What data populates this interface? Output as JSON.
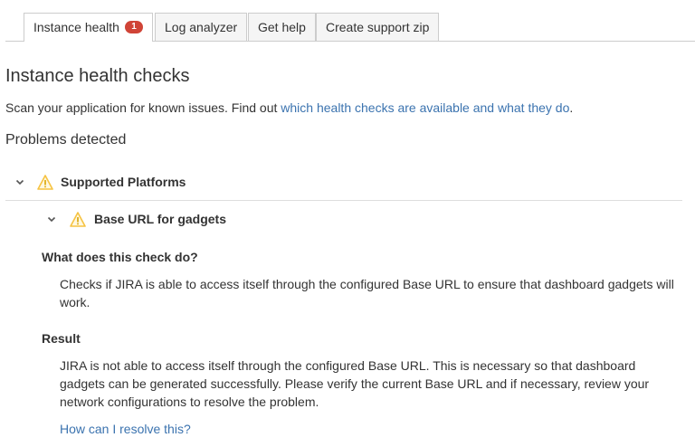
{
  "tabs": [
    {
      "label": "Instance health",
      "badge": "1",
      "active": true
    },
    {
      "label": "Log analyzer",
      "active": false
    },
    {
      "label": "Get help",
      "active": false
    },
    {
      "label": "Create support zip",
      "active": false
    }
  ],
  "header": {
    "title": "Instance health checks",
    "intro_text": "Scan your application for known issues. Find out ",
    "intro_link": "which health checks are available and what they do",
    "intro_end": ".",
    "problems_heading": "Problems detected"
  },
  "group": {
    "label": "Supported Platforms",
    "icon": "warning-icon",
    "check": {
      "label": "Base URL for gadgets",
      "icon": "warning-icon",
      "what_heading": "What does this check do?",
      "what_text": "Checks if JIRA is able to access itself through the configured Base URL to ensure that dashboard gadgets will work.",
      "result_heading": "Result",
      "result_text": "JIRA is not able to access itself through the configured Base URL. This is necessary so that dashboard gadgets can be generated successfully. Please verify the current Base URL and if necessary, review your network configurations to resolve the problem.",
      "resolve_link": "How can I resolve this?"
    }
  },
  "colors": {
    "link": "#3b73af",
    "badge": "#d04437",
    "warning": "#f6c342",
    "text": "#333333"
  }
}
